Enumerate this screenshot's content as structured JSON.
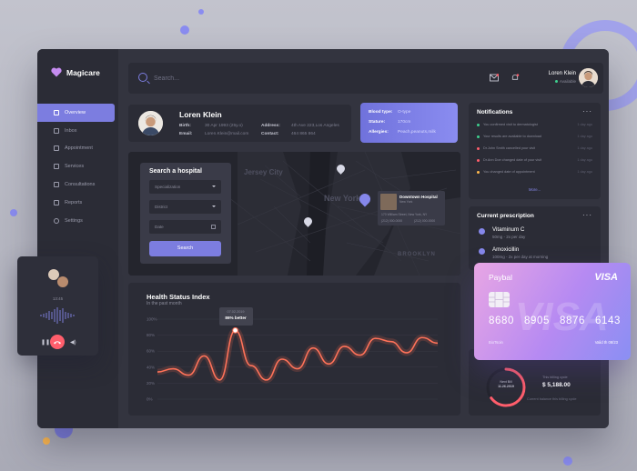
{
  "app": {
    "name": "Magicare"
  },
  "sidebar": {
    "items": [
      {
        "label": "Overview",
        "icon": "grid-icon",
        "active": true
      },
      {
        "label": "Inbox",
        "icon": "inbox-icon"
      },
      {
        "label": "Appointment",
        "icon": "calendar-icon"
      },
      {
        "label": "Services",
        "icon": "layers-icon"
      },
      {
        "label": "Consultations",
        "icon": "chat-icon"
      },
      {
        "label": "Reports",
        "icon": "report-icon"
      },
      {
        "label": "Settings",
        "icon": "gear-icon"
      }
    ]
  },
  "topbar": {
    "search_placeholder": "Search...",
    "user_name": "Loren Klein",
    "user_status": "Available"
  },
  "profile": {
    "name": "Loren Klein",
    "birth_label": "Birth:",
    "birth_value": "30 Apr 1993 (25y.o)",
    "email_label": "Email:",
    "email_value": "Loren.Klein@mail.com",
    "address_label": "Address:",
    "address_value": "4th Ave 223,Los Angeles",
    "contact_label": "Contact:",
    "contact_value": "464 865 864"
  },
  "medical": {
    "blood_label": "Blood type:",
    "blood_value": "O-type",
    "stature_label": "Stature:",
    "stature_value": "170cm",
    "allergies_label": "Allergies:",
    "allergies_value": "Peach,peanuts,milk"
  },
  "hospital_search": {
    "title": "Search a hospital",
    "specialization": "Specialization",
    "district": "District",
    "date": "Date",
    "button": "Search"
  },
  "map": {
    "labels": [
      "Jersey City",
      "New York",
      "BROOKLYN"
    ],
    "popup_name": "Downtown Hospital",
    "popup_sub": "New York",
    "popup_address": "170 William Street, New York, NY",
    "popup_phone_1": "(212) 000-0000",
    "popup_phone_2": "(212) 000-0000"
  },
  "health": {
    "title": "Health Status Index",
    "subtitle": "In the past month",
    "tooltip_date": "07.02.2019",
    "tooltip_value": "86% better",
    "y_ticks": [
      "100%",
      "80%",
      "60%",
      "40%",
      "20%",
      "0%"
    ]
  },
  "chart_data": {
    "type": "line",
    "title": "Health Status Index",
    "subtitle": "In the past month",
    "xlabel": "",
    "ylabel": "",
    "ylim": [
      0,
      100
    ],
    "grid": true,
    "series": [
      {
        "values": [
          34,
          38,
          30,
          54,
          24,
          86,
          42,
          24,
          50,
          38,
          64,
          44,
          66,
          55,
          76,
          72,
          58,
          77,
          70
        ]
      }
    ],
    "annotations": [
      {
        "label": "86% better",
        "date": "07.02.2019"
      }
    ]
  },
  "notifications": {
    "title": "Notifications",
    "more": "More...",
    "items": [
      {
        "text": "You confirmed visit to dermatologist",
        "time": "1 day ago",
        "color": "#3ecf8e"
      },
      {
        "text": "Your results are available to download",
        "time": "1 day ago",
        "color": "#3ecf8e"
      },
      {
        "text": "Dr.John Smith cancelled your visit",
        "time": "1 day ago",
        "color": "#ff5e6c"
      },
      {
        "text": "Dr.Ann Doe changed date of your visit",
        "time": "1 day ago",
        "color": "#ff5e6c"
      },
      {
        "text": "You changed date of appointment",
        "time": "1 day ago",
        "color": "#ffb84d"
      }
    ]
  },
  "prescription": {
    "title": "Current prescription",
    "items": [
      {
        "name": "Vitaminum C",
        "dose": "50mg - 2x per day"
      },
      {
        "name": "Amoxicillin",
        "dose": "100mg - 2x per day at morning"
      }
    ]
  },
  "billing": {
    "next_label": "Next Bill",
    "next_date": "11.26.2019",
    "cycle_label": "This billing cycle",
    "amount": "$ 5,188.00",
    "balance_label": "Current balance this billing cycle",
    "progress": 0.65
  },
  "card": {
    "bank": "Paybal",
    "brand": "VISA",
    "number": [
      "8680",
      "8905",
      "8876",
      "6143"
    ],
    "holder": "BioTsoin",
    "valid": "Valid th 08/23"
  },
  "call": {
    "duration": "13:45"
  },
  "colors": {
    "accent": "#7c7de0",
    "danger": "#ff5e6c",
    "success": "#3ecf8e"
  }
}
